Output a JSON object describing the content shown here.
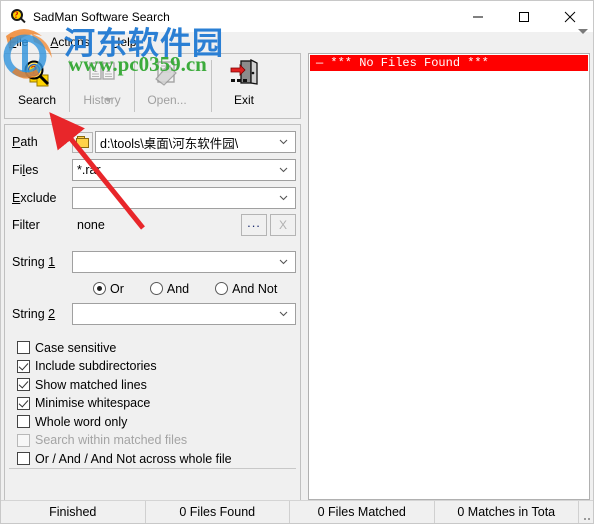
{
  "window": {
    "title": "SadMan Software Search",
    "icon": "search-app-icon",
    "controls": {
      "minimize": "minimize-icon",
      "maximize": "maximize-icon",
      "close": "close-icon"
    }
  },
  "menu": {
    "items": [
      {
        "label": "File",
        "accel": "F"
      },
      {
        "label": "Actions",
        "accel": "A"
      },
      {
        "label": "Help",
        "accel": "H"
      }
    ]
  },
  "toolbar": {
    "buttons": [
      {
        "label": "Search",
        "icon": "magnifier-folder-icon",
        "enabled": true,
        "dropdown": "none"
      },
      {
        "label": "History",
        "icon": "book-pages-icon",
        "enabled": false,
        "dropdown": "below"
      },
      {
        "label": "Open...",
        "icon": "open-document-icon",
        "enabled": false,
        "dropdown": "right"
      },
      {
        "label": "Exit",
        "icon": "door-exit-icon",
        "enabled": true,
        "dropdown": "none"
      }
    ]
  },
  "form": {
    "path": {
      "label": "Path",
      "accel": "P",
      "value": "d:\\tools\\桌面\\河东软件园\\",
      "browse_icon": "folder-browse-icon"
    },
    "files": {
      "label": "Files",
      "accel": "l",
      "value": "*.rar"
    },
    "exclude": {
      "label": "Exclude",
      "accel": "E",
      "value": ""
    },
    "filter": {
      "label": "Filter",
      "value": "none",
      "browse_button": "...",
      "clear_button": "X",
      "clear_enabled": false
    },
    "string1": {
      "label": "String 1",
      "accel": "1",
      "value": ""
    },
    "string2": {
      "label": "String 2",
      "accel": "2",
      "value": ""
    },
    "operators": [
      {
        "label": "Or",
        "selected": true
      },
      {
        "label": "And",
        "selected": false
      },
      {
        "label": "And Not",
        "selected": false
      }
    ],
    "checkboxes": [
      {
        "label": "Case sensitive",
        "checked": false,
        "enabled": true
      },
      {
        "label": "Include subdirectories",
        "checked": true,
        "enabled": true
      },
      {
        "label": "Show matched lines",
        "checked": true,
        "enabled": true
      },
      {
        "label": "Minimise whitespace",
        "checked": true,
        "enabled": true
      },
      {
        "label": "Whole word only",
        "checked": false,
        "enabled": true
      },
      {
        "label": "Search within matched files",
        "checked": false,
        "enabled": false
      },
      {
        "label": "Or / And / And Not across whole file",
        "checked": false,
        "enabled": true
      }
    ]
  },
  "results": {
    "rows": [
      {
        "text": "— *** No Files Found ***",
        "highlight_color": "#ff0000",
        "text_color": "#ffffff"
      }
    ]
  },
  "statusbar": {
    "cells": [
      "Finished",
      "0 Files Found",
      "0 Files Matched",
      "0 Matches in Tota"
    ]
  },
  "watermark": {
    "chinese": "河东软件园",
    "url": "www.pc0359.cn",
    "chinese_color": "#2a7fd4",
    "url_color": "#3cab3c",
    "logo": "watermark-logo-icon"
  },
  "annotation": {
    "arrow_color": "#e8262a",
    "name": "red-pointer-arrow"
  }
}
